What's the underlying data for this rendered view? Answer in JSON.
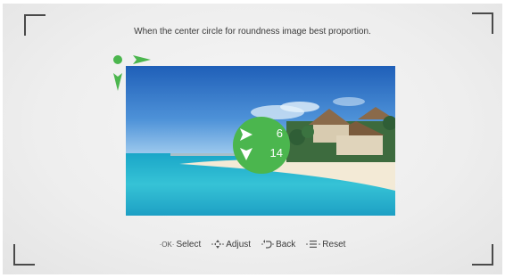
{
  "instruction": "When the center circle for roundness image best proportion.",
  "indicator": {
    "icons": [
      "dot-icon",
      "arrow-right-icon",
      "arrow-down-icon"
    ],
    "color": "#4bb64e"
  },
  "picture": {
    "subject": "beach-scene"
  },
  "adjust_circle": {
    "horizontal_value": "6",
    "vertical_value": "14",
    "color": "#4bb64e"
  },
  "footer": {
    "select": {
      "key": "OK",
      "label": "Select"
    },
    "adjust": {
      "key_icon": "dpad-icon",
      "label": "Adjust"
    },
    "back": {
      "key_icon": "back-icon",
      "label": "Back"
    },
    "reset": {
      "key_icon": "menu-icon",
      "label": "Reset"
    }
  }
}
